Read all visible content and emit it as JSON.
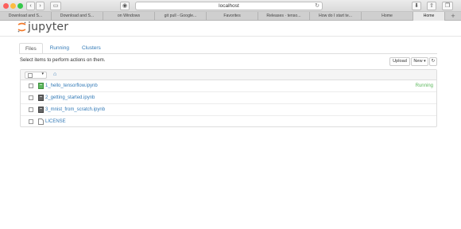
{
  "browser": {
    "address": "localhost",
    "tabs": [
      "Download and S...",
      "Download and S...",
      "on Windows",
      "git pull - Google...",
      "Favorites",
      "Releases · tenso...",
      "How do I start te...",
      "Home",
      "Home"
    ],
    "new_tab": "+"
  },
  "jupyter": {
    "logo_text": "jupyter",
    "tabs": [
      "Files",
      "Running",
      "Clusters"
    ],
    "instructions": "Select items to perform actions on them.",
    "upload_label": "Upload",
    "new_label": "New",
    "files": [
      {
        "name": "1_hello_tensorflow.ipynb",
        "status": "Running",
        "kind": "notebook-running"
      },
      {
        "name": "2_getting_started.ipynb",
        "status": "",
        "kind": "notebook"
      },
      {
        "name": "3_mnist_from_scratch.ipynb",
        "status": "",
        "kind": "notebook"
      },
      {
        "name": "LICENSE",
        "status": "",
        "kind": "file"
      }
    ]
  },
  "colors": {
    "link": "#337ab7",
    "running": "#5cb85c",
    "logo_orange": "#f37726"
  },
  "icons": [
    "back-icon",
    "forward-icon",
    "sidebar-icon",
    "privacy-icon",
    "reload-icon",
    "download-icon",
    "share-icon",
    "tabs-icon",
    "home-icon",
    "notebook-icon",
    "file-icon"
  ]
}
